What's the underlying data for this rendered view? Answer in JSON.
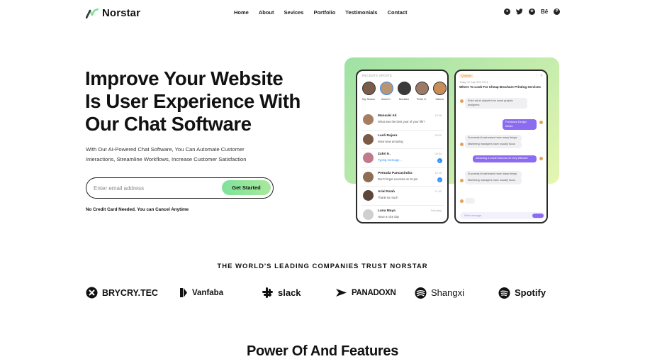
{
  "brand": {
    "name": "Norstar",
    "accent": "#7fe29a"
  },
  "nav": {
    "items": [
      {
        "label": "Home"
      },
      {
        "label": "About"
      },
      {
        "label": "Sevices"
      },
      {
        "label": "Portfolio"
      },
      {
        "label": "Testimonials"
      },
      {
        "label": "Contact"
      }
    ]
  },
  "socials": [
    {
      "icon": "github-icon"
    },
    {
      "icon": "twitter-icon"
    },
    {
      "icon": "dribbble-icon",
      "glyph": "❀"
    },
    {
      "icon": "behance-icon",
      "glyph": "Bē"
    },
    {
      "icon": "pinterest-icon",
      "glyph": "P"
    }
  ],
  "hero": {
    "title_lines": [
      "Improve Your Website",
      "Is User Experience With",
      "Our Chat Software"
    ],
    "subtitle_lines": [
      "With Our AI-Powered Chat Software, You Can Automate Customer",
      "Interactions, Streamline Workflows, Increase Customer Satisfaction"
    ],
    "email_placeholder": "Enter email address",
    "cta_label": "Get Started",
    "note": "No Credit Card Needed. You can Cancel Anytime"
  },
  "mockup": {
    "recents_label": "RECENTS UPDATE",
    "stories": [
      {
        "name": "My Status"
      },
      {
        "name": "Zahri K."
      },
      {
        "name": "Modden"
      },
      {
        "name": "Peter K."
      },
      {
        "name": "Salma"
      }
    ],
    "chats": [
      {
        "name": "Mansuki Ali",
        "message": "What was the best year of your life?",
        "time": "10:28",
        "badge": ""
      },
      {
        "name": "Laoli Rajora",
        "message": "Wow wow amazing",
        "time": "09:32",
        "badge": ""
      },
      {
        "name": "Zahri K.",
        "message": "Typing message...",
        "time": "08:54",
        "badge": "1",
        "typing": true
      },
      {
        "name": "Pemuda Pancasindra",
        "message": "Don't forget excesise at 10 pm",
        "time": "12:15",
        "badge": "2"
      },
      {
        "name": "Ariel Noah",
        "message": "Thank so much",
        "time": "11:02",
        "badge": ""
      },
      {
        "name": "Luna Maya",
        "message": "Have a nice day",
        "time": "Saturday",
        "badge": ""
      }
    ],
    "conversation": {
      "tag": "Question",
      "date": "Today, 12 July 2025 10:15",
      "topic": "Where To Look For Cheap Brochure Printing Services",
      "messages": [
        {
          "dir": "in",
          "text": "Enim ad mi aliquet from some graphic designers",
          "time": ""
        },
        {
          "dir": "out",
          "text": "Freelance Design Media",
          "time": ""
        },
        {
          "dir": "in",
          "text": "Successful businesses have many things",
          "time": ""
        },
        {
          "dir": "in",
          "text": "Marketing managers have usually focus",
          "time": ""
        },
        {
          "dir": "out",
          "text": "Attracting a model that can be very effective",
          "time": ""
        },
        {
          "dir": "in",
          "text": "Successful businesses have many things",
          "time": ""
        },
        {
          "dir": "in",
          "text": "Marketing managers have usually focus",
          "time": ""
        }
      ],
      "composer_placeholder": "Write message"
    }
  },
  "trust": {
    "heading": "THE WORLD'S LEADING COMPANIES TRUST NORSTAR",
    "companies": [
      {
        "name": "BRYCRY.TEC",
        "icon": "brycry-icon"
      },
      {
        "name": "Vanfaba",
        "icon": "vanfaba-icon"
      },
      {
        "name": "slack",
        "icon": "slack-icon"
      },
      {
        "name": "PANADOXN",
        "icon": "panadoxn-icon"
      },
      {
        "name": "Shangxi",
        "icon": "shangxi-icon"
      },
      {
        "name": "Spotify",
        "icon": "spotify-icon"
      }
    ]
  },
  "features": {
    "heading": "Power Of And Features"
  }
}
